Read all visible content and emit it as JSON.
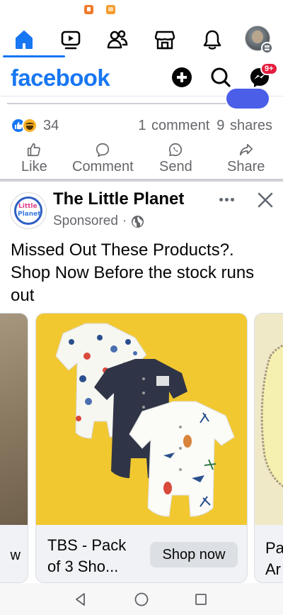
{
  "nav": {
    "tabs": [
      {
        "name": "Home",
        "icon": "home-icon",
        "active": true
      },
      {
        "name": "Watch",
        "icon": "video-icon"
      },
      {
        "name": "Friends",
        "icon": "friends-icon"
      },
      {
        "name": "Marketplace",
        "icon": "marketplace-icon"
      },
      {
        "name": "Notifications",
        "icon": "bell-icon"
      },
      {
        "name": "Menu",
        "icon": "avatar-menu-icon"
      }
    ],
    "active_color": "#1877f2"
  },
  "header": {
    "logo_text": "facebook",
    "messenger_badge": "9+",
    "brand_color": "#1877f2"
  },
  "previous_post": {
    "reaction_count": "34",
    "comments": "1 comment",
    "shares": "9 shares",
    "actions": {
      "like": "Like",
      "comment": "Comment",
      "send": "Send",
      "share": "Share"
    }
  },
  "ad_post": {
    "advertiser": "The Little Planet",
    "sponsored_label": "Sponsored",
    "separator": "·",
    "text": "Missed Out These Products?. Shop Now Before the stock runs out",
    "carousel": {
      "left_card_text": "w",
      "main_card": {
        "title": "TBS - Pack of 3 Sho...",
        "button": "Shop now",
        "image_bg": "#f2c830"
      },
      "right_card_text": "Pa\nAr"
    }
  }
}
